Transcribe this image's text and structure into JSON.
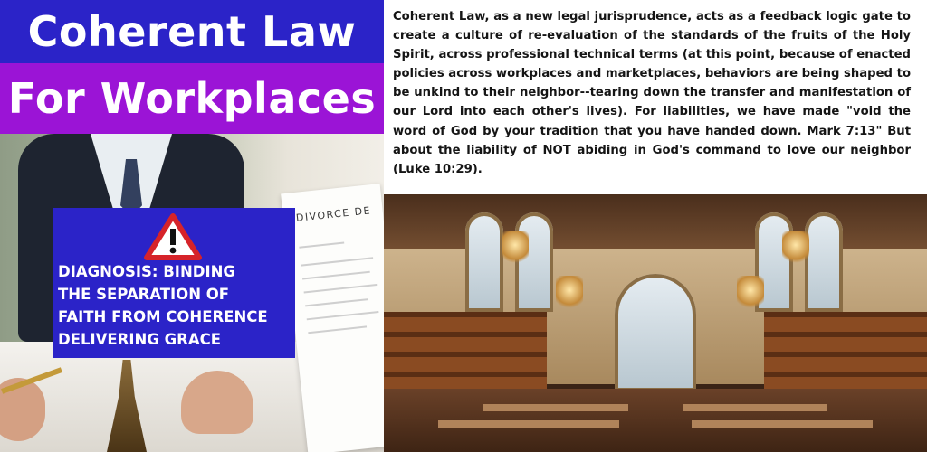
{
  "header": {
    "title_line1": "Coherent Law",
    "title_line2": "For Workplaces"
  },
  "left_image": {
    "document_label": "DIVORCE DE",
    "diagnosis": {
      "icon": "warning-icon",
      "line1": "DIAGNOSIS: BINDING",
      "line2": "THE SEPARATION OF",
      "line3": "FAITH FROM COHERENCE",
      "line4": "DELIVERING GRACE"
    }
  },
  "body": {
    "paragraph": "Coherent Law, as a new legal jurisprudence, acts as a feedback logic gate to create a culture of re-evaluation of the standards of the fruits of the Holy Spirit, across professional technical terms (at this point, because of enacted policies across workplaces and marketplaces, behaviors are being shaped to be unkind to their neighbor--tearing down the transfer and manifestation of our Lord into each other's lives). For liabilities, we have made \"void the word of God by your tradition that you have handed down. Mark 7:13\" But about the liability of NOT abiding in God's command to love our neighbor (Luke 10:29)."
  },
  "colors": {
    "title_blue": "#2b23c8",
    "title_purple": "#9b14d6",
    "warning_red": "#d6232a"
  }
}
